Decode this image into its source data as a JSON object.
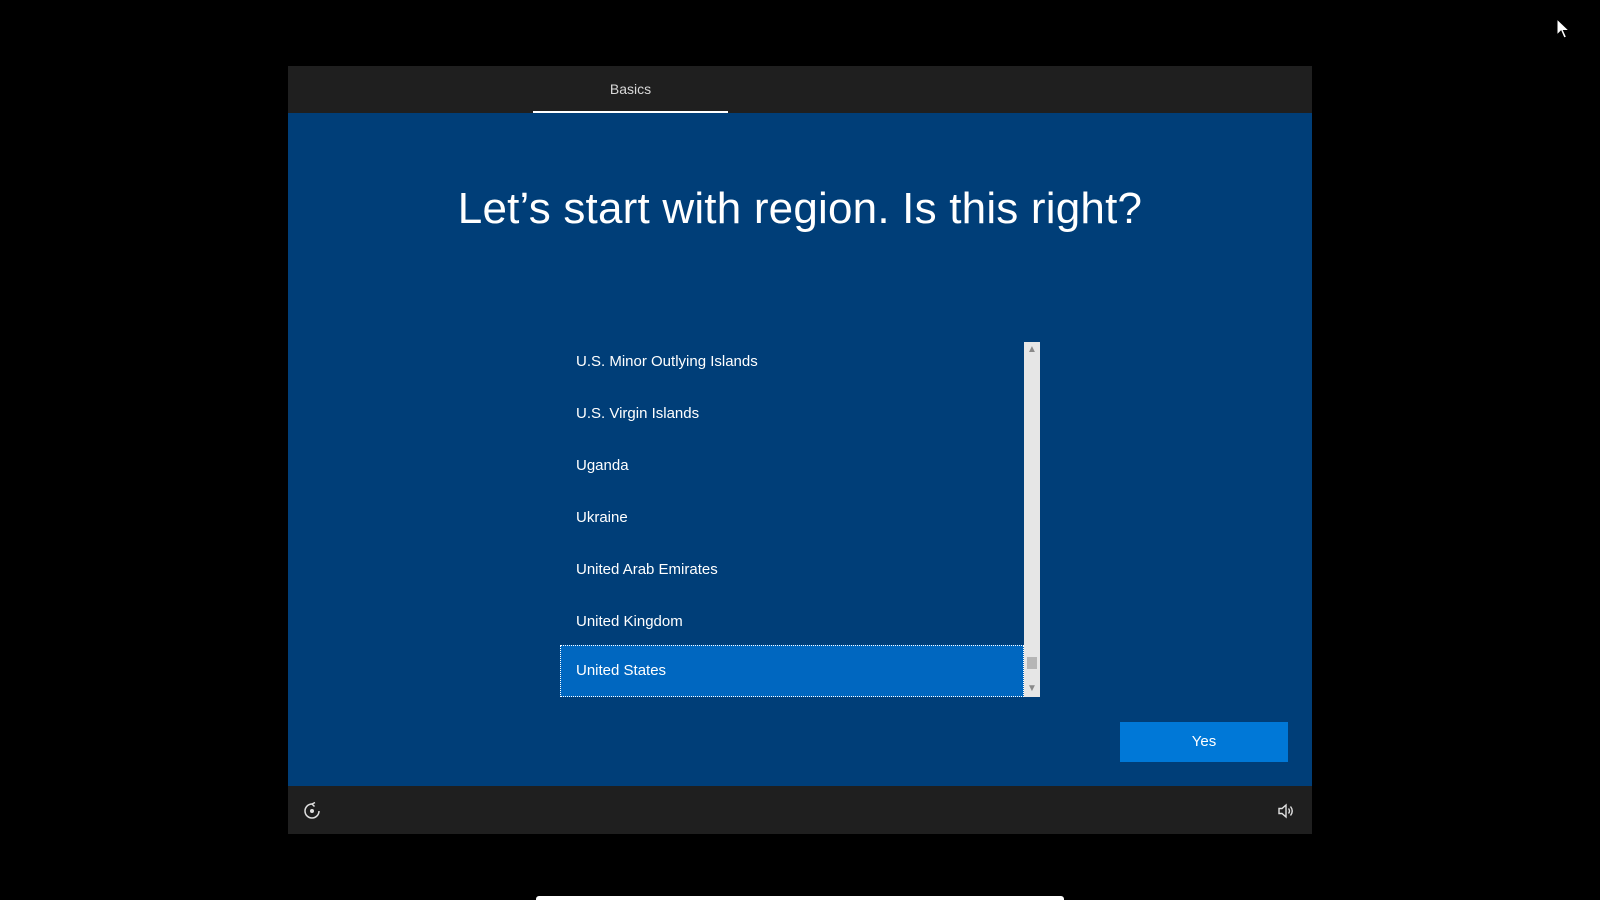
{
  "header": {
    "tab_label": "Basics"
  },
  "main": {
    "title": "Let’s start with region. Is this right?",
    "regions": [
      "U.S. Minor Outlying Islands",
      "U.S. Virgin Islands",
      "Uganda",
      "Ukraine",
      "United Arab Emirates",
      "United Kingdom",
      "United States"
    ],
    "selected_region": "United States",
    "yes_label": "Yes"
  },
  "footer": {
    "left_icon": "ease-of-access-icon",
    "right_icon": "volume-icon"
  },
  "colors": {
    "window_background": "#003e78",
    "bar_background": "#1f1f1f",
    "accent": "#0078d7",
    "selected_item": "#0067c0"
  }
}
